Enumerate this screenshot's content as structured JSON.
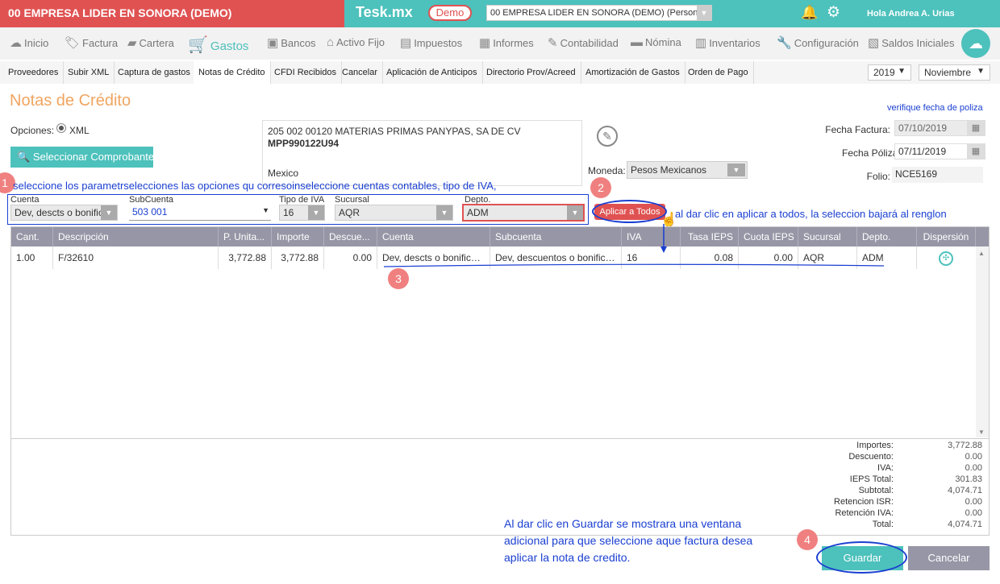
{
  "topbar": {
    "company": "00 EMPRESA LIDER EN SONORA (DEMO)",
    "brand": "Tesk.mx",
    "demo_label": "Demo",
    "company_select": "00 EMPRESA LIDER EN SONORA (DEMO) (Persona",
    "greeting": "Hola Andrea A. Urias"
  },
  "main_menu": [
    {
      "label": "Inicio",
      "icon": "cloud-icon"
    },
    {
      "label": "Factura",
      "icon": "tag-icon"
    },
    {
      "label": "Cartera",
      "icon": "wallet-icon"
    },
    {
      "label": "Gastos",
      "icon": "cart-icon"
    },
    {
      "label": "Bancos",
      "icon": "bank-icon"
    },
    {
      "label": "Activo Fijo",
      "icon": "house-icon"
    },
    {
      "label": "Impuestos",
      "icon": "briefcase-icon"
    },
    {
      "label": "Informes",
      "icon": "document-icon"
    },
    {
      "label": "Contabilidad",
      "icon": "ledger-icon"
    },
    {
      "label": "Nómina",
      "icon": "card-icon"
    },
    {
      "label": "Inventarios",
      "icon": "box-icon"
    },
    {
      "label": "Configuración",
      "icon": "wrench-icon"
    },
    {
      "label": "Saldos Iniciales",
      "icon": "balance-icon"
    }
  ],
  "sub_menu": [
    "Proveedores",
    "Subir XML",
    "Captura de gastos",
    "Notas de Crédito",
    "CFDI Recibidos",
    "Cancelar",
    "Aplicación de Anticipos",
    "Directorio Prov/Acreed",
    "Amortización de Gastos",
    "Orden de Pago"
  ],
  "year_select": "2019",
  "month_select": "Noviembre",
  "page_title": "Notas de Crédito",
  "verify_link": "verifique fecha de poliza",
  "options": {
    "label": "Opciones:",
    "xml": "XML"
  },
  "select_button": "Seleccionar Comprobante",
  "supplier": {
    "name": "205 002 00120 MATERIAS PRIMAS PANYPAS, SA DE CV",
    "rfc": "MPP990122U94",
    "country": "Mexico"
  },
  "currency": {
    "label": "Moneda:",
    "value": "Pesos Mexicanos"
  },
  "dates": {
    "factura_label": "Fecha Factura:",
    "factura_value": "07/10/2019",
    "poliza_label": "Fecha Póliza",
    "poliza_value": "07/11/2019",
    "folio_label": "Folio:",
    "folio_value": "NCE5169"
  },
  "annotations": {
    "n1": "1",
    "n2": "2",
    "n3": "3",
    "n4": "4",
    "note1": "seleccione los parametrselecciones las opciones qu corresoinseleccione cuentas contables, tipo de IVA,",
    "note2": "al dar clic en aplicar a todos, la seleccion bajará al renglon",
    "note4": "Al dar clic en Guardar se mostrara una ventana adicional para que seleccione aque factura desea aplicar la nota de credito."
  },
  "params": {
    "cuenta_label": "Cuenta",
    "cuenta_value": "Dev, descts o bonificac",
    "subcuenta_label": "SubCuenta",
    "subcuenta_value": "503 001",
    "iva_label": "Tipo de IVA",
    "iva_value": "16",
    "sucursal_label": "Sucursal",
    "sucursal_value": "AQR",
    "depto_label": "Depto.",
    "depto_value": "ADM"
  },
  "apply_button": "Aplicar a Todos",
  "grid": {
    "columns": [
      "Cant.",
      "Descripción",
      "P. Unita...",
      "Importe",
      "Descue...",
      "Cuenta",
      "Subcuenta",
      "IVA",
      "Tasa IEPS",
      "Cuota IEPS",
      "Sucursal",
      "Depto.",
      "Dispersión"
    ],
    "rows": [
      {
        "cant": "1.00",
        "descripcion": "F/32610",
        "precio": "3,772.88",
        "importe": "3,772.88",
        "descuento": "0.00",
        "cuenta": "Dev, descts o bonificac...",
        "subcuenta": "Dev, descuentos o bonifica...",
        "iva": "16",
        "tasa_ieps": "0.08",
        "cuota_ieps": "0.00",
        "sucursal": "AQR",
        "depto": "ADM"
      }
    ]
  },
  "totals": [
    {
      "label": "Importes:",
      "value": "3,772.88"
    },
    {
      "label": "Descuento:",
      "value": "0.00"
    },
    {
      "label": "IVA:",
      "value": "0.00"
    },
    {
      "label": "IEPS Total:",
      "value": "301.83"
    },
    {
      "label": "Subtotal:",
      "value": "4,074.71"
    },
    {
      "label": "Retencion ISR:",
      "value": "0.00"
    },
    {
      "label": "Retención IVA:",
      "value": "0.00"
    },
    {
      "label": "Total:",
      "value": "4,074.71"
    }
  ],
  "save_button": "Guardar",
  "cancel_button": "Cancelar",
  "colors": {
    "teal": "#4dc1bc",
    "red": "#e05252",
    "annotation": "#1a3fd1",
    "header_gray": "#9696a6"
  }
}
